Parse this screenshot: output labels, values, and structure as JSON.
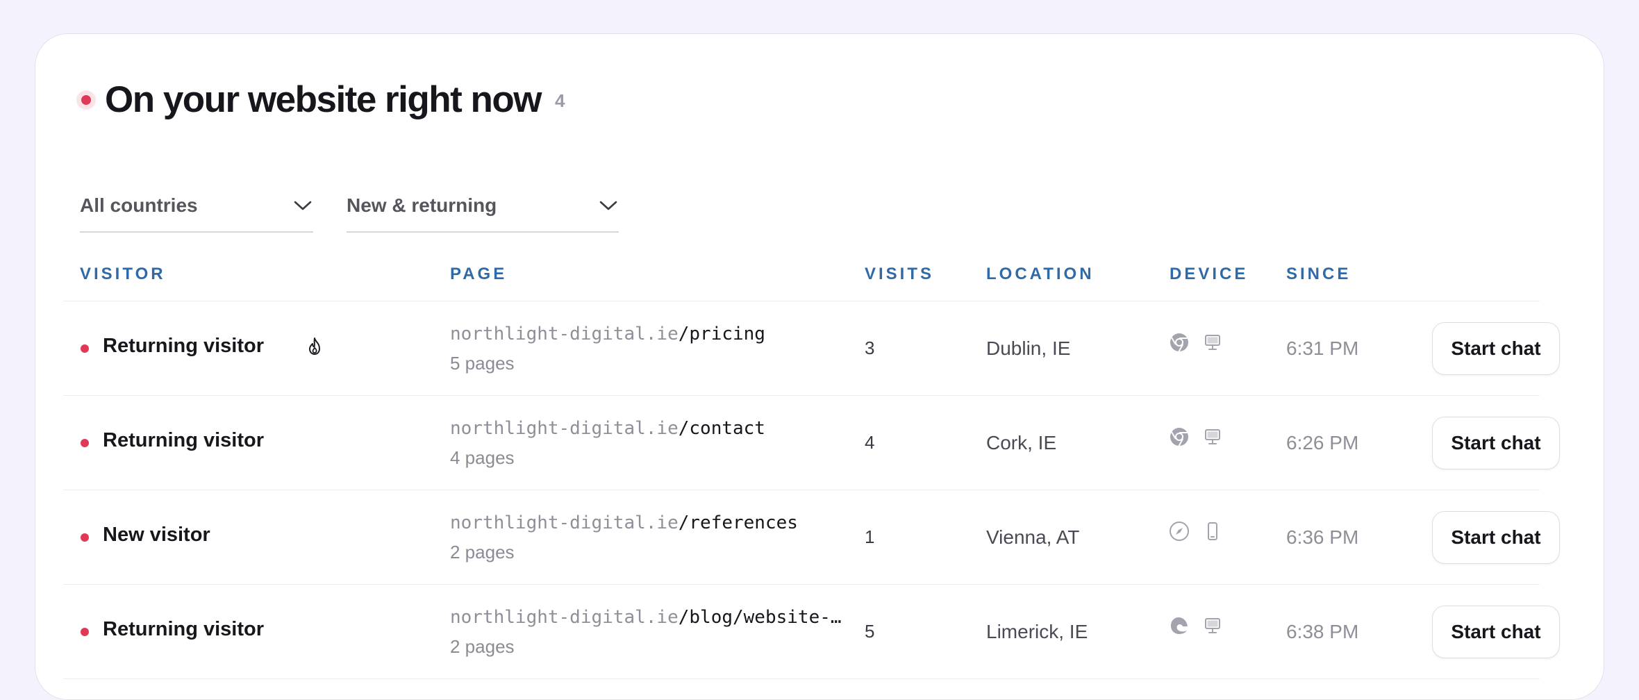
{
  "header": {
    "title": "On your website right now",
    "count": "4"
  },
  "filters": {
    "country": "All countries",
    "visitor_type": "New & returning"
  },
  "columns": {
    "visitor": "VISITOR",
    "page": "PAGE",
    "visits": "VISITS",
    "location": "LOCATION",
    "device": "DEVICE",
    "since": "SINCE"
  },
  "rows": [
    {
      "visitor": "Returning visitor",
      "hot": true,
      "domain": "northlight-digital.ie",
      "path": "/pricing",
      "pages": "5 pages",
      "visits": "3",
      "location": "Dublin, IE",
      "browser_icon": "chrome-icon",
      "device_icon": "desktop-icon",
      "since": "6:31 PM",
      "action": "Start chat"
    },
    {
      "visitor": "Returning visitor",
      "hot": false,
      "domain": "northlight-digital.ie",
      "path": "/contact",
      "pages": "4 pages",
      "visits": "4",
      "location": "Cork, IE",
      "browser_icon": "chrome-icon",
      "device_icon": "desktop-icon",
      "since": "6:26 PM",
      "action": "Start chat"
    },
    {
      "visitor": "New visitor",
      "hot": false,
      "domain": "northlight-digital.ie",
      "path": "/references",
      "pages": "2 pages",
      "visits": "1",
      "location": "Vienna, AT",
      "browser_icon": "safari-icon",
      "device_icon": "mobile-icon",
      "since": "6:36 PM",
      "action": "Start chat"
    },
    {
      "visitor": "Returning visitor",
      "hot": false,
      "domain": "northlight-digital.ie",
      "path": "/blog/website-re…",
      "pages": "2 pages",
      "visits": "5",
      "location": "Limerick, IE",
      "browser_icon": "edge-icon",
      "device_icon": "desktop-icon",
      "since": "6:38 PM",
      "action": "Start chat"
    }
  ],
  "colors": {
    "accent_red": "#e03957",
    "header_blue": "#2f6aa8",
    "background": "#f3f2fd"
  }
}
